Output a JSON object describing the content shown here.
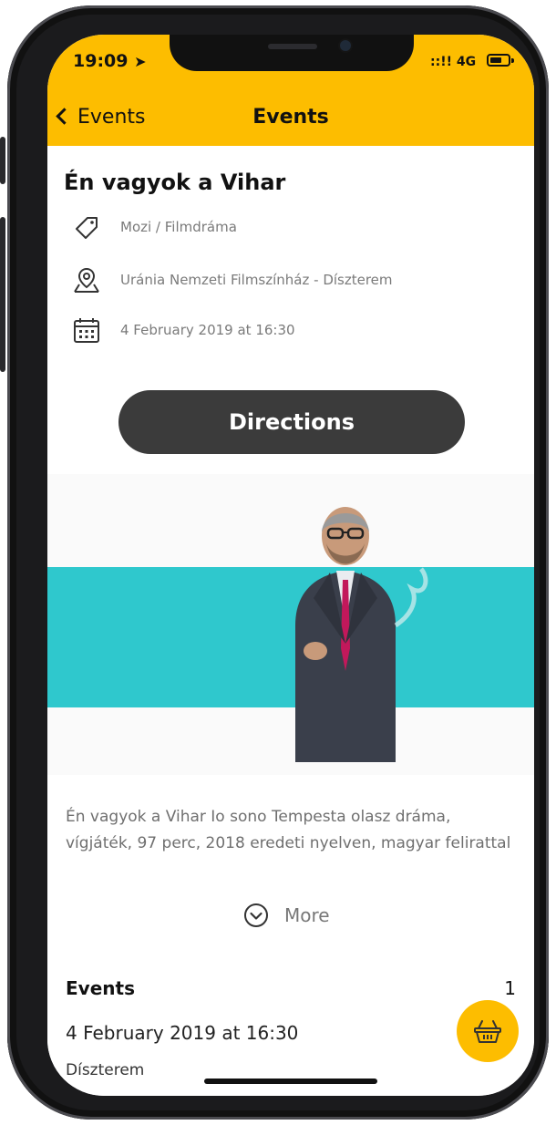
{
  "status_bar": {
    "time": "19:09",
    "location_glyph": "➤",
    "signal": "::!! 4G"
  },
  "nav": {
    "back_label": "Events",
    "title": "Events"
  },
  "event": {
    "title": "Én vagyok a Vihar",
    "category": "Mozi / Filmdráma",
    "venue": "Uránia Nemzeti Filmszínház - Díszterem",
    "datetime": "4 February 2019 at 16:30",
    "directions_label": "Directions",
    "description": "Én vagyok a Vihar Io sono Tempesta olasz dráma, vígjáték, 97 perc, 2018 eredeti nyelven, magyar felirattal",
    "more_label": "More"
  },
  "events_section": {
    "heading": "Events",
    "count": "1",
    "items": [
      {
        "date": "4 February 2019 at 16:30",
        "place": "Díszterem"
      }
    ]
  },
  "colors": {
    "accent": "#fdbd00",
    "button_dark": "#3b3b3b",
    "hero_band": "#2fc8cd"
  },
  "icons": [
    "tag-icon",
    "location-pin-icon",
    "calendar-icon",
    "chevron-down-circle-icon",
    "basket-icon",
    "chevron-left-icon"
  ]
}
